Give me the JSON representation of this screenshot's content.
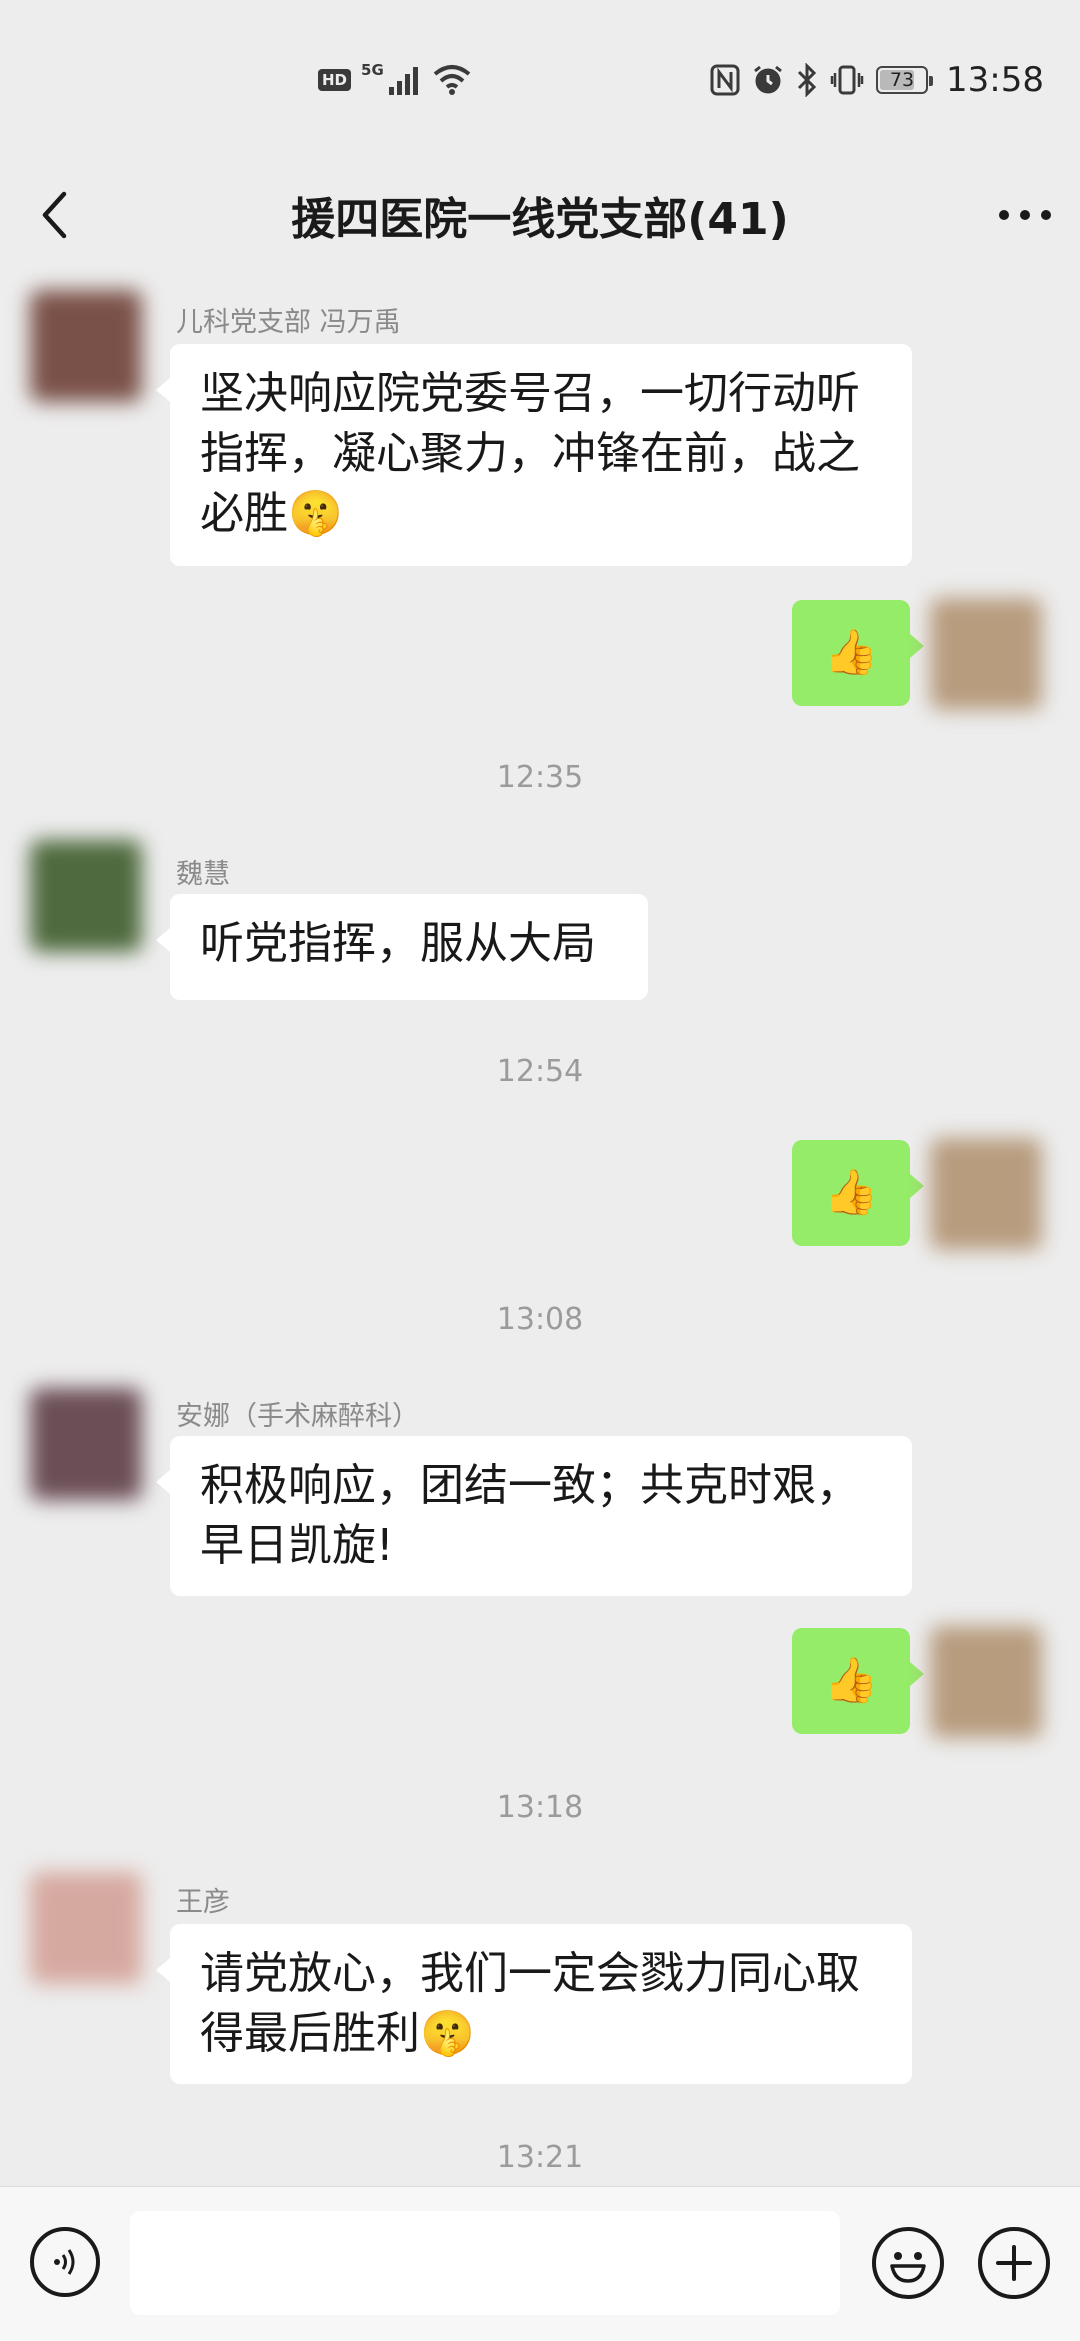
{
  "status_bar": {
    "hd_label": "HD",
    "network_label": "5G",
    "battery_level": "73",
    "time": "13:58"
  },
  "header": {
    "title": "援四医院一线党支部(41)"
  },
  "messages": [
    {
      "type": "incoming",
      "sender": "儿科党支部  冯万禹",
      "text": "坚决响应院党委号召，一切行动听指挥，凝心聚力，冲锋在前，战之必胜",
      "emoji": "🤫"
    },
    {
      "type": "outgoing",
      "emoji": "👍"
    },
    {
      "type": "time",
      "text": "12:35"
    },
    {
      "type": "incoming",
      "sender": "魏慧",
      "text": "听党指挥，服从大局"
    },
    {
      "type": "time",
      "text": "12:54"
    },
    {
      "type": "outgoing",
      "emoji": "👍"
    },
    {
      "type": "time",
      "text": "13:08"
    },
    {
      "type": "incoming",
      "sender": "安娜（手术麻醉科）",
      "text": "积极响应，团结一致；共克时艰，早日凯旋!"
    },
    {
      "type": "outgoing",
      "emoji": "👍"
    },
    {
      "type": "time",
      "text": "13:18"
    },
    {
      "type": "incoming",
      "sender": "王彦",
      "text": "请党放心，我们一定会戮力同心取得最后胜利",
      "emoji": "🤫"
    },
    {
      "type": "time",
      "text": "13:21"
    }
  ],
  "input_bar": {
    "value": "",
    "placeholder": ""
  },
  "colors": {
    "background": "#ededed",
    "outgoing_bubble": "#95ec69",
    "incoming_bubble": "#ffffff"
  },
  "icons": {
    "back": "chevron-left-icon",
    "more": "more-dots-icon",
    "voice": "voice-icon",
    "emoji": "smiley-icon",
    "plus": "plus-icon"
  }
}
